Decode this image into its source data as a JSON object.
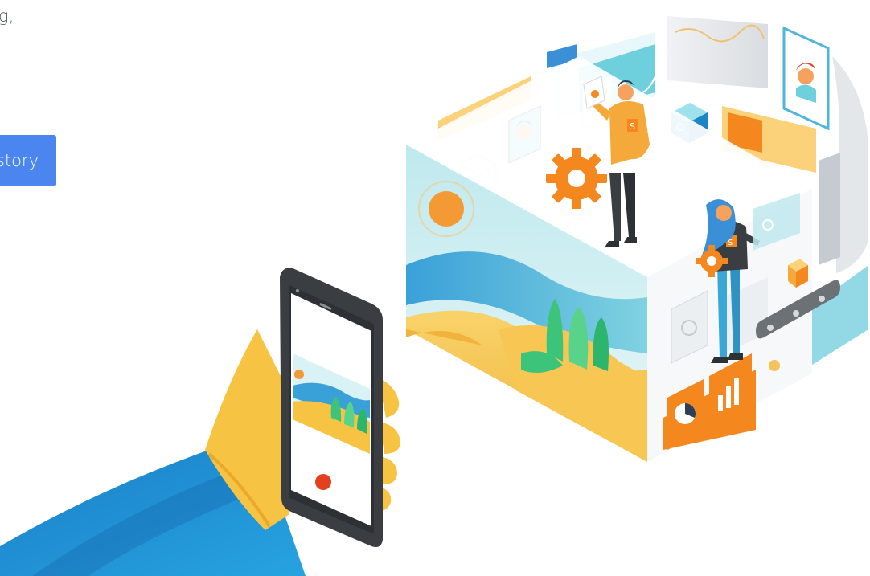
{
  "hero": {
    "text_fragment": "g,",
    "cta_label": "story"
  },
  "colors": {
    "accent": "#4b86f0",
    "sleeve_blue": "#1e8fd4",
    "hand_yellow": "#f6c343",
    "phone_dark": "#3a3d42",
    "orange": "#f5871f",
    "teal": "#6fd0dd",
    "sand": "#f4c35a",
    "green": "#3cc47a"
  },
  "illustration": {
    "icons": [
      "hand-icon",
      "smartphone-icon",
      "record-icon",
      "gear-icon",
      "person-icon",
      "landscape-panel-icon",
      "pie-chart-icon",
      "bar-chart-icon",
      "cube-icon",
      "conveyor-icon",
      "line-chart-icon"
    ]
  }
}
